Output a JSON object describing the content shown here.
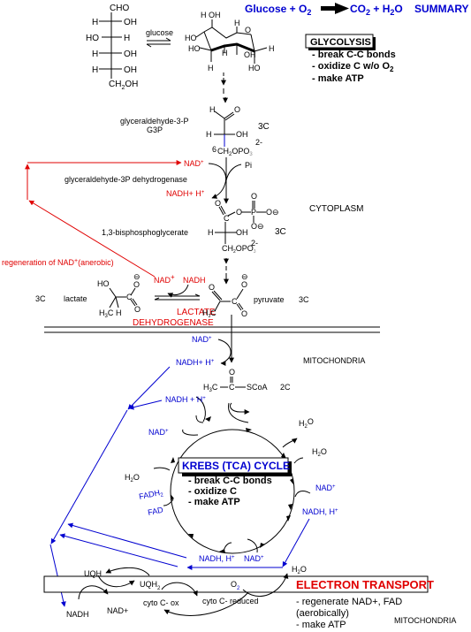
{
  "summary": {
    "equation_left": "Glucose + O",
    "equation_left_sub": "2",
    "equation_right_co2": "CO",
    "equation_right_co2_sub": "2",
    "equation_right_plus": " + H",
    "equation_right_h2o_sub": "2",
    "equation_right_o": "O",
    "title": "SUMMARY"
  },
  "glucose_fischer": {
    "top": "CHO",
    "rows": [
      {
        "left": "H",
        "right": "OH"
      },
      {
        "left": "HO",
        "right": "H"
      },
      {
        "left": "H",
        "right": "OH"
      },
      {
        "left": "H",
        "right": "OH"
      }
    ],
    "bottom_a": "CH",
    "bottom_sub": "2",
    "bottom_b": "OH",
    "equilibrium_label": "glucose"
  },
  "glucose_ring": {
    "labels": [
      "H",
      "OH",
      "H",
      "O",
      "HO",
      "HO",
      "H",
      "OH",
      "H",
      "H",
      "HO"
    ]
  },
  "glycolysis_box": {
    "title": "GLYCOLYSIS",
    "points": [
      "- break C-C bonds",
      "- oxidize C w/o O",
      "- make ATP"
    ],
    "point2_sub": "2"
  },
  "g3p": {
    "name": "glyceraldehyde-3-P",
    "abbrev": "G3P",
    "carbons": "3C",
    "atoms": {
      "h_top": "H",
      "o_top": "O",
      "h_left": "H",
      "oh": "OH",
      "num": "6",
      "ch2opo3": "CH",
      "sub2": "2",
      "opo": "OPO",
      "sub3": "3",
      "charge": "2-"
    }
  },
  "g3p_step": {
    "nad": "NAD",
    "nad_sup": "+",
    "pi": "Pi",
    "enzyme": "glyceraldehyde-3P dehydrogenase",
    "nadh": "NADH+ H",
    "nadh_sup": "+"
  },
  "bpg": {
    "name": "1,3-bisphosphoglycerate",
    "carbons": "3C",
    "atoms": {
      "o_carbonyl": "O",
      "c": "C",
      "o_link": "O",
      "p": "P",
      "o_top": "O",
      "o_minus1": "O⊖",
      "o_minus2": "O⊖",
      "h": "H",
      "oh": "OH",
      "ch2": "CH",
      "sub2": "2",
      "opo": "OPO",
      "sub3": "3",
      "charge": "2-"
    }
  },
  "region_labels": {
    "cytoplasm": "CYTOPLASM",
    "mitochondria_1": "MITOCHONDRIA",
    "mitochondria_2": "MITOCHONDRIA"
  },
  "anaerobic": {
    "regen_label": "regeneration of NAD",
    "regen_sup": "+",
    "regen_tail": "(anerobic)",
    "lactate_carbons": "3C",
    "lactate_name": "lactate",
    "lactate_atoms": {
      "ho": "HO",
      "h3c": "H",
      "sub3": "3",
      "c_letter": "C",
      "h": "H",
      "c": "C",
      "o_minus": "⊖",
      "o1": "O",
      "o2": "O"
    },
    "nad": "NAD",
    "nad_sup": "+",
    "nadh": "NADH",
    "enzyme_line1": "LACTATE",
    "enzyme_line2": "DEHYDROGENASE"
  },
  "pyruvate": {
    "name": "pyruvate",
    "carbons": "3C",
    "atoms": {
      "o_keto": "O",
      "h3c": "H",
      "sub3": "3",
      "c_letter": "C",
      "c": "C",
      "o_minus": "⊖",
      "o1": "O",
      "o2": "O"
    }
  },
  "pdh_step": {
    "nad": "NAD",
    "nad_sup": "+",
    "nadh": "NADH+ H",
    "nadh_sup": "+"
  },
  "acetyl_coa": {
    "o": "O",
    "h3c": "H",
    "sub3": "3",
    "c_letter": "C",
    "c": "C",
    "scoa": "SCoA",
    "carbons": "2C"
  },
  "krebs": {
    "title": "KREBS (TCA) CYCLE",
    "points": [
      "- break C-C bonds",
      "- oxidize C",
      "- make ATP"
    ],
    "labels": {
      "nadh_top": "NADH + H",
      "nadh_top_sup": "+",
      "nad_left": "NAD",
      "nad_left_sup": "+",
      "h2o_left": "H",
      "h2o_left_sub": "2",
      "h2o_left_o": "O",
      "fadh2": "FADH",
      "fadh2_sub": "2",
      "fad": "FAD",
      "h2o_top_right": "H",
      "h2o_top_right_sub": "2",
      "h2o_top_right_o": "O",
      "h2o_right": "H",
      "h2o_right_sub": "2",
      "h2o_right_o": "O",
      "nad_right": "NAD",
      "nad_right_sup": "+",
      "nadh_right": "NADH, H",
      "nadh_right_sup": "+",
      "nadh_bottom": "NADH, H",
      "nadh_bottom_sup": "+",
      "nad_bottom": "NAD",
      "nad_bottom_sup": "+"
    }
  },
  "electron_transport": {
    "title": "ELECTRON TRANSPORT",
    "points": [
      "- regenerate NAD+, FAD",
      "(aerobically)",
      "- make ATP"
    ],
    "h2o": "H",
    "h2o_sub": "2",
    "h2o_o": "O",
    "uqh": "UQH",
    "uqh2": "UQH",
    "uqh2_sub": "2",
    "o2": "O",
    "o2_sub": "2",
    "nadh": "NADH",
    "nad_plus": "NAD+",
    "cyto_ox": "cyto C- ox",
    "cyto_red": "cyto C- reduced"
  },
  "colors": {
    "red": "#e00000",
    "blue": "#0000d0",
    "black": "#000000"
  }
}
